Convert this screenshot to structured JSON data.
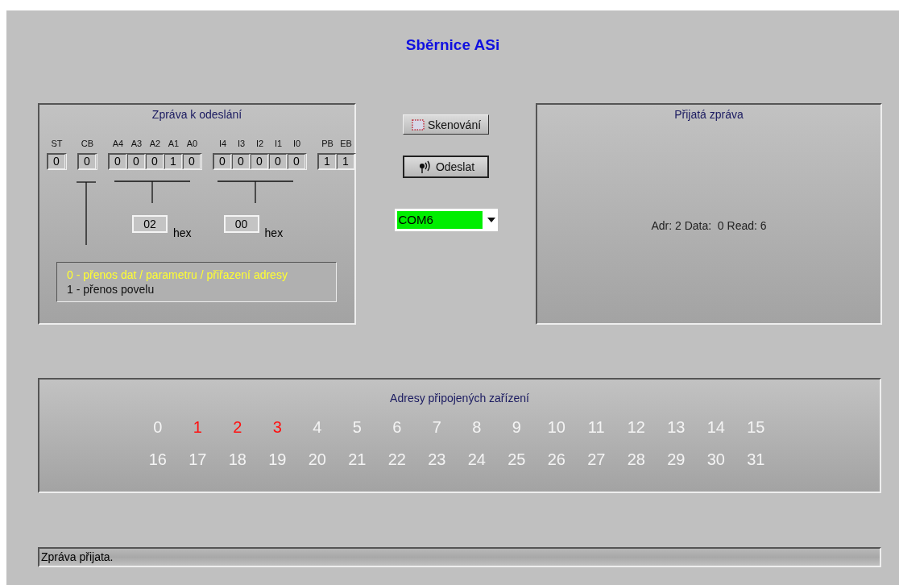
{
  "title": "Sběrnice ASi",
  "send_panel": {
    "title": "Zpráva k odeslání",
    "bit_groups": [
      {
        "bits": [
          {
            "label": "ST",
            "value": "0"
          }
        ]
      },
      {
        "bits": [
          {
            "label": "CB",
            "value": "0"
          }
        ]
      },
      {
        "bits": [
          {
            "label": "A4",
            "value": "0"
          },
          {
            "label": "A3",
            "value": "0"
          },
          {
            "label": "A2",
            "value": "0"
          },
          {
            "label": "A1",
            "value": "1"
          },
          {
            "label": "A0",
            "value": "0"
          }
        ]
      },
      {
        "bits": [
          {
            "label": "I4",
            "value": "0"
          },
          {
            "label": "I3",
            "value": "0"
          },
          {
            "label": "I2",
            "value": "0"
          },
          {
            "label": "I1",
            "value": "0"
          },
          {
            "label": "I0",
            "value": "0"
          }
        ]
      },
      {
        "bits": [
          {
            "label": "PB",
            "value": "1"
          },
          {
            "label": "EB",
            "value": "1"
          }
        ]
      }
    ],
    "hex_fields": [
      {
        "value": "02",
        "unit": "hex"
      },
      {
        "value": "00",
        "unit": "hex"
      }
    ],
    "legend": [
      {
        "text": "0 - přenos dat / parametru / přiřazení adresy",
        "selected": true
      },
      {
        "text": "1 - přenos povelu",
        "selected": false
      }
    ]
  },
  "buttons": [
    {
      "label": "Skenování",
      "kind": "scan"
    },
    {
      "label": "Odeslat",
      "kind": "send"
    }
  ],
  "port_select": {
    "value": "COM6"
  },
  "received_panel": {
    "title": "Přijatá zpráva",
    "message": "Adr: 2 Data:  0 Read: 6"
  },
  "addresses_panel": {
    "title": "Adresy připojených zařízení",
    "addresses": [
      {
        "label": "0",
        "active": false
      },
      {
        "label": "1",
        "active": true
      },
      {
        "label": "2",
        "active": true
      },
      {
        "label": "3",
        "active": true
      },
      {
        "label": "4",
        "active": false
      },
      {
        "label": "5",
        "active": false
      },
      {
        "label": "6",
        "active": false
      },
      {
        "label": "7",
        "active": false
      },
      {
        "label": "8",
        "active": false
      },
      {
        "label": "9",
        "active": false
      },
      {
        "label": "10",
        "active": false
      },
      {
        "label": "11",
        "active": false
      },
      {
        "label": "12",
        "active": false
      },
      {
        "label": "13",
        "active": false
      },
      {
        "label": "14",
        "active": false
      },
      {
        "label": "15",
        "active": false
      },
      {
        "label": "16",
        "active": false
      },
      {
        "label": "17",
        "active": false
      },
      {
        "label": "18",
        "active": false
      },
      {
        "label": "19",
        "active": false
      },
      {
        "label": "20",
        "active": false
      },
      {
        "label": "21",
        "active": false
      },
      {
        "label": "22",
        "active": false
      },
      {
        "label": "23",
        "active": false
      },
      {
        "label": "24",
        "active": false
      },
      {
        "label": "25",
        "active": false
      },
      {
        "label": "26",
        "active": false
      },
      {
        "label": "27",
        "active": false
      },
      {
        "label": "28",
        "active": false
      },
      {
        "label": "29",
        "active": false
      },
      {
        "label": "30",
        "active": false
      },
      {
        "label": "31",
        "active": false
      }
    ]
  },
  "status_bar": {
    "text": "Zpráva přijata."
  }
}
